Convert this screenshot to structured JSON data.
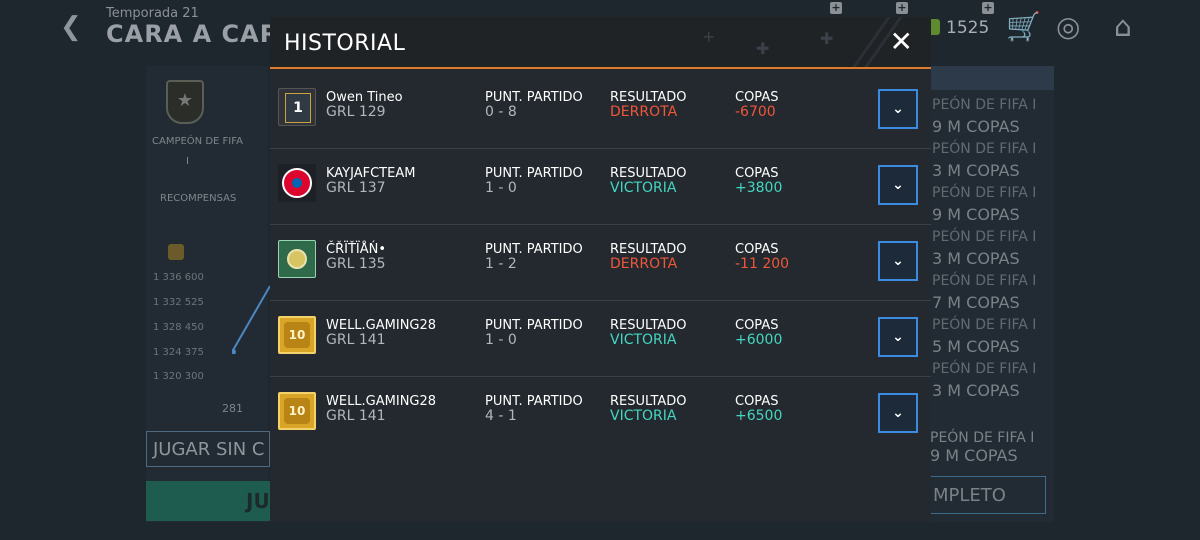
{
  "header": {
    "season": "Temporada 21",
    "mode": "CARA A CARA",
    "coins": "1525"
  },
  "left_panel": {
    "title": "CAMPEÓN DE FIFA",
    "subtitle": "I",
    "rewards": "RECOMPENSAS",
    "y_ticks": [
      "1 336 600",
      "1 332 525",
      "1 328 450",
      "1 324 375",
      "1 320 300"
    ],
    "x_tick": "281",
    "play_input": "JUGAR SIN C",
    "play_button": "JU"
  },
  "right_panel": {
    "rows": [
      {
        "a": "PEÓN DE FIFA I",
        "b": "9 M COPAS"
      },
      {
        "a": "PEÓN DE FIFA I",
        "b": "3 M COPAS"
      },
      {
        "a": "PEÓN DE FIFA I",
        "b": "9 M COPAS"
      },
      {
        "a": "PEÓN DE FIFA I",
        "b": "3 M COPAS"
      },
      {
        "a": "PEÓN DE FIFA I",
        "b": "7 M COPAS"
      },
      {
        "a": "PEÓN DE FIFA I",
        "b": "5 M COPAS"
      },
      {
        "a": "PEÓN DE FIFA I",
        "b": "3 M COPAS"
      }
    ],
    "footer_a": "PEÓN DE FIFA I",
    "footer_b": "9 M COPAS",
    "button": "MPLETO"
  },
  "modal": {
    "title": "HISTORIAL",
    "close_icon": "close-icon",
    "labels": {
      "score": "PUNT. PARTIDO",
      "result": "RESULTADO",
      "cups": "COPAS"
    },
    "matches": [
      {
        "name": "Owen Tineo",
        "grl": "GRL 129",
        "score": "0 - 8",
        "result": "DERROTA",
        "cups": "-6700",
        "avatar": "badge-1",
        "avatar_text": "1"
      },
      {
        "name": "KAYJAFCTEAM",
        "grl": "GRL 137",
        "score": "1 - 0",
        "result": "VICTORIA",
        "cups": "+3800",
        "avatar": "bayern-crest"
      },
      {
        "name": "ČŘÏŤÏÅŃ•",
        "grl": "GRL 135",
        "score": "1 - 2",
        "result": "DERROTA",
        "cups": "-11 200",
        "avatar": "green-ball"
      },
      {
        "name": "WELL.GAMING28",
        "grl": "GRL 141",
        "score": "1 - 0",
        "result": "VICTORIA",
        "cups": "+6000",
        "avatar": "gold-10",
        "avatar_text": "10"
      },
      {
        "name": "WELL.GAMING28",
        "grl": "GRL 141",
        "score": "4 - 1",
        "result": "VICTORIA",
        "cups": "+6500",
        "avatar": "gold-10",
        "avatar_text": "10"
      }
    ]
  },
  "colors": {
    "accent": "#e07a2d",
    "loss": "#f0563a",
    "win": "#45d6c2",
    "expand_border": "#3d8be0"
  }
}
